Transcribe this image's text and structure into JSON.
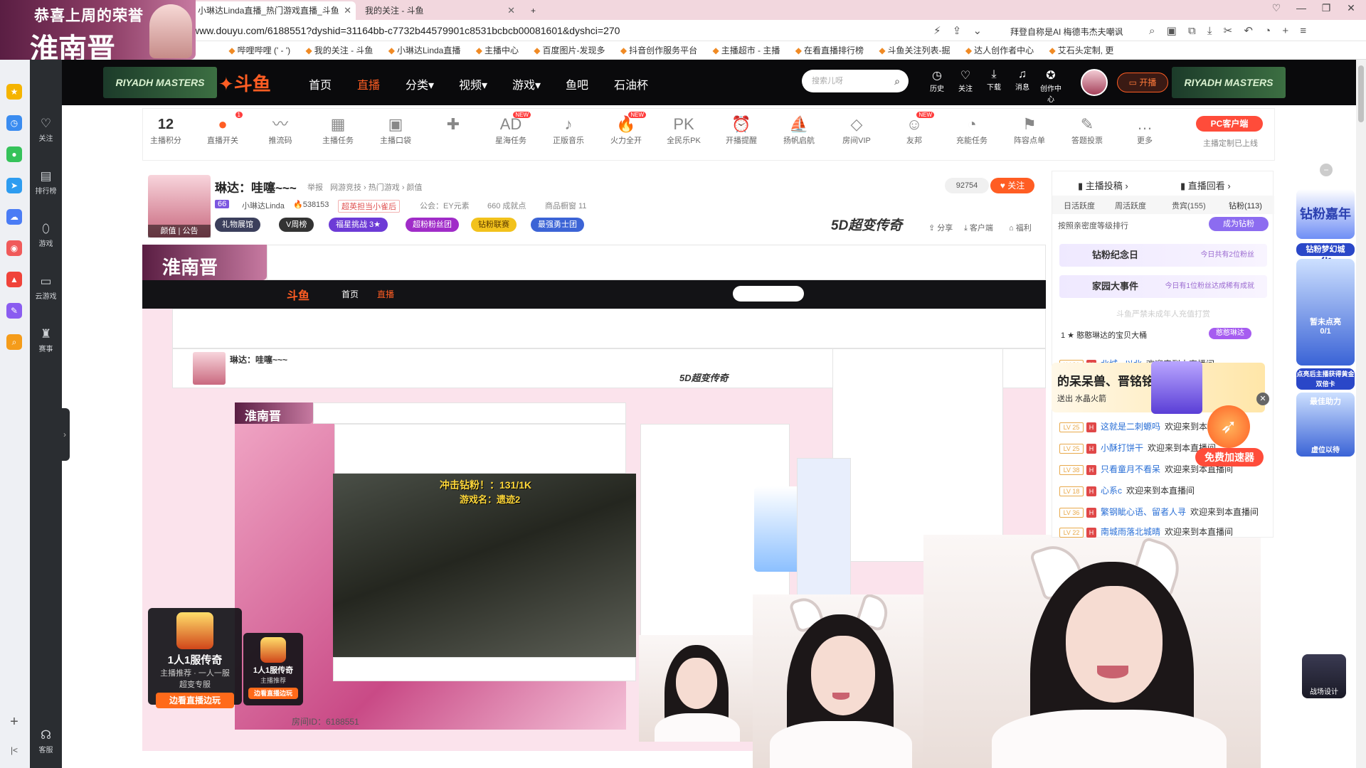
{
  "browser": {
    "tabs": [
      {
        "label": "小琳达Linda直播_热门游戏直播_斗鱼"
      },
      {
        "label": "我的关注 - 斗鱼"
      }
    ],
    "url": "www.douyu.com/6188551?dyshid=31164bb-c7732b44579901c8531bcbcb00081601&dyshci=270",
    "ai_text": "拜登自称是AI 梅德韦杰夫嘲讽",
    "bookmarks": [
      "哔哩哔哩 (' - ')",
      "我的关注 - 斗鱼",
      "小琳达Linda直播",
      "主播中心",
      "百度图片-发现多",
      "抖音创作服务平台",
      "主播超市 - 主播",
      "在看直播排行榜",
      "斗鱼关注列表-掘",
      "达人创作者中心",
      "艾石头定制, 更"
    ]
  },
  "overlay": {
    "line1": "恭喜上周的荣誉",
    "line2": "淮南晋"
  },
  "douyu_nav": {
    "left_items": [
      "关注",
      "排行榜",
      "游戏",
      "云游戏",
      "赛事",
      "客服"
    ],
    "top_items": [
      "首页",
      "直播",
      "分类",
      "视频",
      "游戏",
      "鱼吧",
      "石油杯"
    ],
    "active": "直播",
    "banner_text": "RIYADH MASTERS",
    "logo": "斗鱼",
    "search_placeholder": "搜索儿呀",
    "header_icons": [
      "历史",
      "关注",
      "下载",
      "消息",
      "创作中心"
    ],
    "start_live": "开播"
  },
  "toolbar": {
    "score_value": "12",
    "score_label": "主播积分",
    "items": [
      {
        "label": "直播开关",
        "badge": "1"
      },
      {
        "label": "推流码"
      },
      {
        "label": "主播任务"
      },
      {
        "label": "主播口袋"
      },
      {
        "label": ""
      },
      {
        "label": "星海任务",
        "badge": "NEW"
      },
      {
        "label": "正版音乐"
      },
      {
        "label": "火力全开",
        "badge": "NEW"
      },
      {
        "label": "全民乐PK"
      },
      {
        "label": "开播提醒"
      },
      {
        "label": "扬帆启航"
      },
      {
        "label": "房间VIP"
      },
      {
        "label": "友邦",
        "badge": "NEW"
      },
      {
        "label": "充能任务"
      },
      {
        "label": "阵容点单"
      },
      {
        "label": "答题投票"
      },
      {
        "label": "更多"
      }
    ],
    "pc_client": "PC客户端",
    "pc_client_sub": "主播定制已上线"
  },
  "room": {
    "title": "琳达：哇噻~~~",
    "report": "举报",
    "category": "网游竞技 › 热门游戏 › 颜值",
    "level_badge": "66",
    "streamer": "小琳达Linda",
    "heat": "538153",
    "rank_badge": "超英担当小雀后",
    "guild": "公会：EY元素",
    "achievements": "660 成就点",
    "goods": "商品橱窗 11",
    "avatar_labels": "颜值 | 公告",
    "pills": [
      "礼物展馆",
      "V周榜",
      "福星挑战 3★",
      "超粉粉丝团",
      "钻粉联赛",
      "最强勇士团"
    ],
    "followers": "92754",
    "follow": "关注",
    "legend": "5D超变传奇",
    "actions": [
      "分享",
      "客户端",
      "福利"
    ]
  },
  "inner_video": {
    "overlay_text": "淮南晋",
    "game_text1": "冲击钻粉！：131/1K",
    "game_text2": "游戏名：遗迹2",
    "room_id": "房间ID：6188551"
  },
  "right_panel": {
    "tabs": [
      "主播投稿",
      "直播回看"
    ],
    "subtabs": [
      "日活跃度",
      "周活跃度",
      "贵宾(155)",
      "钻粉(113)"
    ],
    "rank_note": "按照亲密度等级排行",
    "become_fan": "成为钻粉",
    "banner1_title": "钻粉纪念日",
    "banner1_side": "今日共有2位粉丝",
    "banner2_title": "家园大事件",
    "banner2_side": "今日有1位粉丝达成稀有成就",
    "notice": "斗鱼严禁未成年人充值打赏",
    "rank1": "憨憨琳达的宝贝大桶",
    "rank1_tag": "憨憨琳达",
    "chats": [
      {
        "lv": "LV 21",
        "name": "北城...以北",
        "msg": "欢迎来到本直播间"
      },
      {
        "lv": "LV 25",
        "name": "这就是二刺螈吗",
        "msg": "欢迎来到本直播间"
      },
      {
        "lv": "LV 25",
        "name": "小酥打饼干",
        "msg": "欢迎来到本直播间"
      },
      {
        "lv": "LV 38",
        "name": "只看童月不看呆",
        "msg": "欢迎来到本直播间"
      },
      {
        "lv": "LV 18",
        "name": "心系c",
        "msg": "欢迎来到本直播间"
      },
      {
        "lv": "LV 36",
        "name": "繁钢眦心语、留者人寻",
        "msg": "欢迎来到本直播间"
      },
      {
        "lv": "LV 22",
        "name": "南城雨落北城晴",
        "msg": "欢迎来到本直播间"
      }
    ]
  },
  "promo": {
    "title": "的呆呆兽、晋铭铭",
    "sub": "送出  水晶火箭",
    "speed": "免费加速器"
  },
  "far_right": {
    "card1": "钻粉嘉年华",
    "card2": "钻粉梦幻城",
    "card3_a": "暂未点亮",
    "card3_b": "0/1",
    "note": "点亮后主播获得黄金双倍卡",
    "card4": "最佳助力",
    "card4_sub": "虚位以待",
    "bottom_logo": "战场设计"
  },
  "game_ad": {
    "title": "1人1服传奇",
    "sub1": "主播推荐",
    "sub2": "一人一服",
    "sub3": "超变专服",
    "button": "边看直播边玩"
  }
}
